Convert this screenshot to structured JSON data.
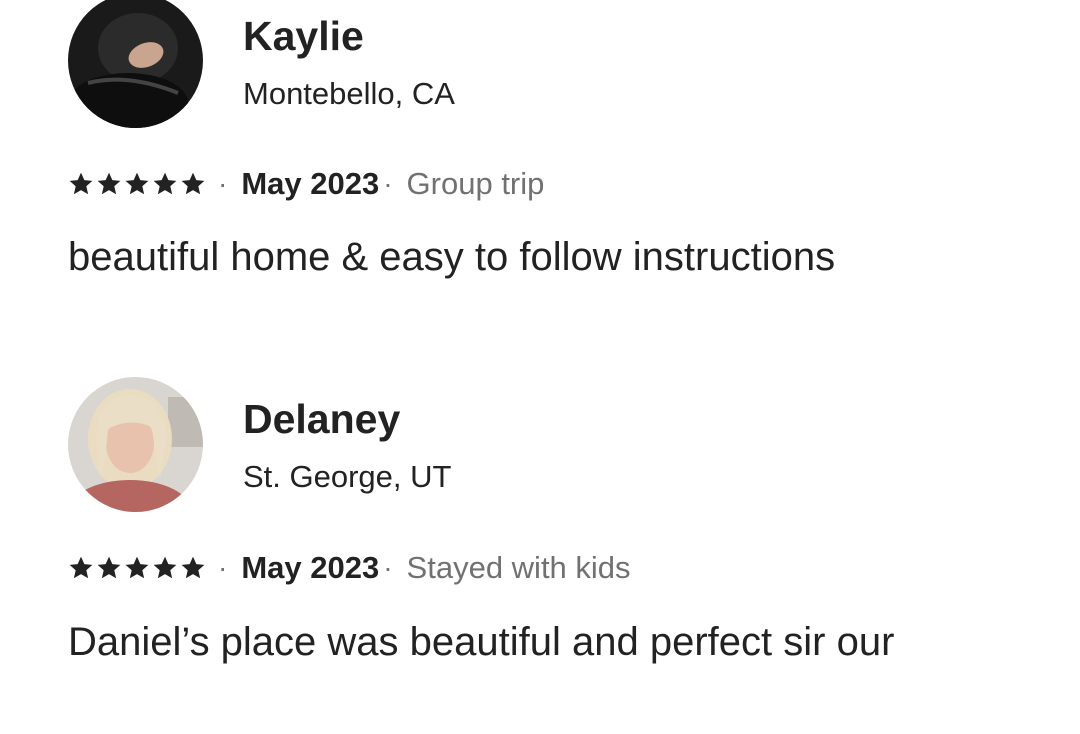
{
  "reviews": [
    {
      "name": "Kaylie",
      "location": "Montebello, CA",
      "rating": 5,
      "date": "May 2023",
      "trip_type": "Group trip",
      "text": "beautiful home & easy to follow instructions"
    },
    {
      "name": "Delaney",
      "location": "St. George, UT",
      "rating": 5,
      "date": "May 2023",
      "trip_type": "Stayed with kids",
      "text": "Daniel’s place was beautiful and perfect sir our"
    }
  ],
  "icons": {
    "star": "star-icon",
    "separator": "·"
  },
  "colors": {
    "primary_text": "#222222",
    "secondary_text": "#717171"
  }
}
